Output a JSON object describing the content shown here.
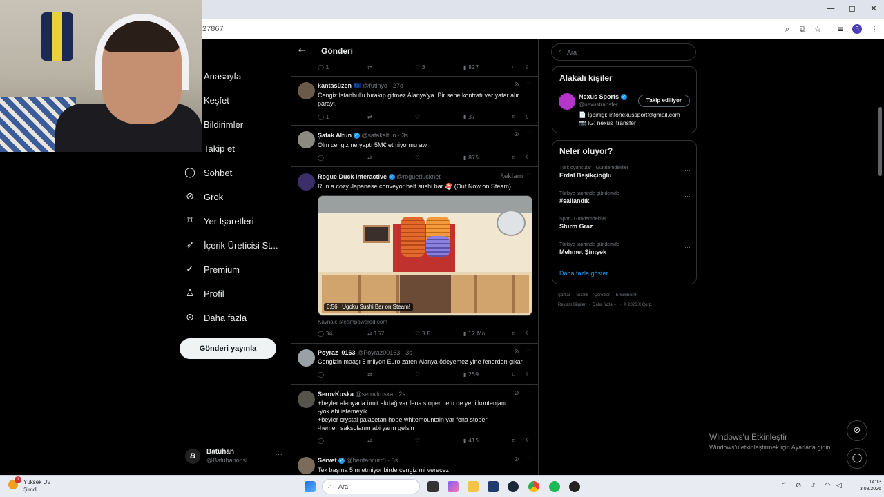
{
  "browser": {
    "url_fragment": "27867",
    "window_controls": {
      "minimize": "—",
      "maximize": "◻",
      "close": "✕"
    },
    "profile_initial": "B"
  },
  "nav": {
    "items": [
      {
        "label": "Anasayfa",
        "icon": "home-icon"
      },
      {
        "label": "Keşfet",
        "icon": "search-icon"
      },
      {
        "label": "Bildirimler",
        "icon": "bell-icon"
      },
      {
        "label": "Takip et",
        "icon": "people-icon"
      },
      {
        "label": "Sohbet",
        "icon": "chat-icon"
      },
      {
        "label": "Grok",
        "icon": "grok-icon"
      },
      {
        "label": "Yer İşaretleri",
        "icon": "bookmark-icon"
      },
      {
        "label": "İçerik Üreticisi St...",
        "icon": "rocket-icon"
      },
      {
        "label": "Premium",
        "icon": "verified-icon"
      },
      {
        "label": "Profil",
        "icon": "user-icon"
      },
      {
        "label": "Daha fazla",
        "icon": "more-circle-icon"
      }
    ],
    "post_button": "Gönderi yayınla",
    "account": {
      "name": "Batuhan",
      "handle": "@Batuhanonsl",
      "avatar": "B",
      "more": "···"
    }
  },
  "timeline": {
    "title": "Gönderi",
    "first_actions": {
      "replies": "1",
      "likes": "3",
      "views": "827"
    },
    "tweets": [
      {
        "name": "kantasüzen",
        "flag": "🇪🇺",
        "handle": "@futinyo · 27d",
        "text": "Cengiz İstanbul'u bırakıp gitmez Alanya'ya. Bir sene kontratı var yatar alır parayı.",
        "replies": "1",
        "retweets": "",
        "likes": "",
        "views": "37"
      },
      {
        "name": "Şafak Altun",
        "handle": "@safakaltun · 3s",
        "text": "Olm cengiz ne yaptı 5M€ etmiyormu aw",
        "replies": "",
        "retweets": "",
        "likes": "",
        "views": "875"
      },
      {
        "name": "Rogue Duck Interactive",
        "handle": "@rogueducknet",
        "ad": "Reklam",
        "text": "Run a cozy Japanese conveyor belt sushi bar 🍣 (Out Now on Steam)",
        "video_time": "0:56",
        "video_caption": "Ugoku Sushi Bar on Steam!",
        "source": "Kaynak: steampowered.com",
        "replies": "34",
        "retweets": "157",
        "likes": "3 B",
        "views": "12 Mn"
      },
      {
        "name": "Poyraz_0163",
        "handle": "@Poyraz00163 · 3s",
        "text": "Cengizin maaşı 5 milyon Euro zaten Alanya ödeyemez yine fenerden çıkar",
        "replies": "",
        "retweets": "",
        "likes": "",
        "views": "259"
      },
      {
        "name": "SerovKuska",
        "handle": "@serovkuska · 2s",
        "lines": [
          "+beyler alanyada ümit akdağ var fena stoper hem de yerli kontenjanı",
          "-yok abi istemeyik",
          "+beyler crystal palacetan hope whitemountain var fena stoper",
          "-hemen saksolarım abi yarın gelsin"
        ],
        "replies": "",
        "retweets": "",
        "likes": "",
        "views": "415"
      },
      {
        "name": "Servet",
        "handle": "@bentancurr8 · 3s",
        "text": "Tek başına 5 m etmiyor birde cengiz mi verecez"
      }
    ]
  },
  "right": {
    "search_placeholder": "Ara",
    "relevant": {
      "title": "Alakalı kişiler",
      "name": "Nexus Sports",
      "handle": "@nexustransfer",
      "follow": "Takip ediliyor",
      "bio1": "📄 İşbirliği: infonexussport@gmail.com",
      "bio2": "📷 IG: nexus_transfer"
    },
    "trends": {
      "title": "Neler oluyor?",
      "items": [
        {
          "context": "Türk oyuncular · Gündemdekiler",
          "name": "Erdal Beşikçioğlu"
        },
        {
          "context": "Türkiye tarihinde gündemde",
          "name": "#sallandık"
        },
        {
          "context": "Spor · Gündemdekiler",
          "name": "Sturm Graz"
        },
        {
          "context": "Türkiye tarihinde gündemde",
          "name": "Mehmet Şimşek"
        }
      ],
      "more": "Daha fazla göster"
    },
    "footer": {
      "l1": [
        "Şartlar",
        "Gizlilik",
        "Çerezler",
        "Erişilebilirlik"
      ],
      "l2": [
        "Reklam Bilgileri",
        "Daha fazla ···",
        "© 2026 X Corp."
      ]
    }
  },
  "watermark": {
    "line1": "Windows'u Etkinleştir",
    "line2": "Windows'u etkinleştirmek için Ayarlar'a gidin."
  },
  "taskbar": {
    "weather_badge": "1",
    "weather_title": "Yüksek UV",
    "weather_sub": "Şimdi",
    "search_placeholder": "Ara",
    "time": "14:13",
    "date": "3.08.2026"
  }
}
